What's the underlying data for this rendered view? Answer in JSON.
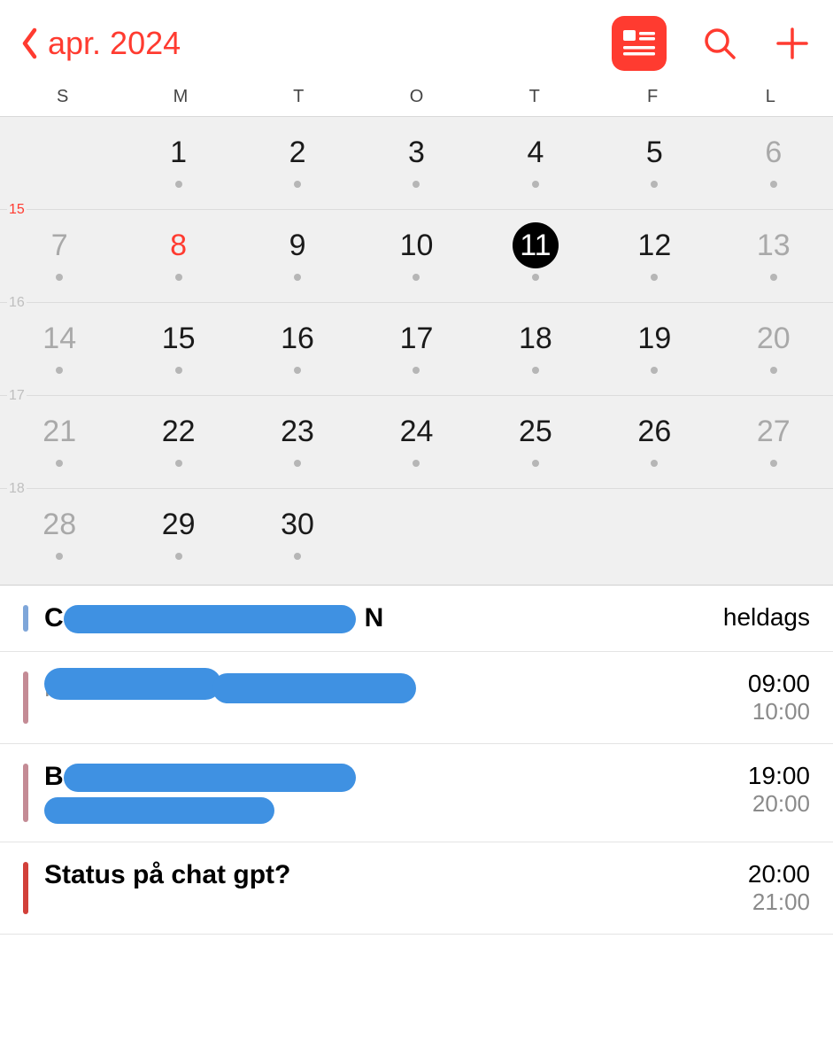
{
  "header": {
    "back_label": "apr. 2024"
  },
  "weekdays": [
    "S",
    "M",
    "T",
    "O",
    "T",
    "F",
    "L"
  ],
  "calendar": {
    "weeks": [
      {
        "number": "15",
        "days": [
          {
            "n": "",
            "dot": false,
            "weekend": true,
            "empty": true
          },
          {
            "n": "1",
            "dot": true,
            "weekend": false
          },
          {
            "n": "2",
            "dot": true,
            "weekend": false
          },
          {
            "n": "3",
            "dot": true,
            "weekend": false
          },
          {
            "n": "4",
            "dot": true,
            "weekend": false
          },
          {
            "n": "5",
            "dot": true,
            "weekend": false
          },
          {
            "n": "6",
            "dot": true,
            "weekend": true
          }
        ]
      },
      {
        "number": "16",
        "days": [
          {
            "n": "7",
            "dot": true,
            "weekend": true
          },
          {
            "n": "8",
            "dot": true,
            "weekend": false,
            "today": true
          },
          {
            "n": "9",
            "dot": true,
            "weekend": false
          },
          {
            "n": "10",
            "dot": true,
            "weekend": false
          },
          {
            "n": "11",
            "dot": true,
            "weekend": false,
            "selected": true
          },
          {
            "n": "12",
            "dot": true,
            "weekend": false
          },
          {
            "n": "13",
            "dot": true,
            "weekend": true
          }
        ]
      },
      {
        "number": "17",
        "days": [
          {
            "n": "14",
            "dot": true,
            "weekend": true
          },
          {
            "n": "15",
            "dot": true,
            "weekend": false
          },
          {
            "n": "16",
            "dot": true,
            "weekend": false
          },
          {
            "n": "17",
            "dot": true,
            "weekend": false
          },
          {
            "n": "18",
            "dot": true,
            "weekend": false
          },
          {
            "n": "19",
            "dot": true,
            "weekend": false
          },
          {
            "n": "20",
            "dot": true,
            "weekend": true
          }
        ]
      },
      {
        "number": "18",
        "days": [
          {
            "n": "21",
            "dot": true,
            "weekend": true
          },
          {
            "n": "22",
            "dot": true,
            "weekend": false
          },
          {
            "n": "23",
            "dot": true,
            "weekend": false
          },
          {
            "n": "24",
            "dot": true,
            "weekend": false
          },
          {
            "n": "25",
            "dot": true,
            "weekend": false
          },
          {
            "n": "26",
            "dot": true,
            "weekend": false
          },
          {
            "n": "27",
            "dot": true,
            "weekend": true
          }
        ]
      },
      {
        "number": "",
        "days": [
          {
            "n": "28",
            "dot": true,
            "weekend": true
          },
          {
            "n": "29",
            "dot": true,
            "weekend": false
          },
          {
            "n": "30",
            "dot": true,
            "weekend": false
          },
          {
            "n": "",
            "dot": false,
            "empty": true
          },
          {
            "n": "",
            "dot": false,
            "empty": true
          },
          {
            "n": "",
            "dot": false,
            "empty": true
          },
          {
            "n": "",
            "dot": false,
            "empty": true
          }
        ]
      }
    ]
  },
  "events": [
    {
      "stripe": "blue",
      "title_visible_prefix": "C",
      "title_visible_suffix": "N",
      "title_redacted": true,
      "subtitle": "",
      "allday_label": "heldags",
      "start": "",
      "end": ""
    },
    {
      "stripe": "rose",
      "title_redacted": true,
      "subtitle_prefix": "Foreslått sted",
      "subtitle_redacted_tail": true,
      "start": "09:00",
      "end": "10:00"
    },
    {
      "stripe": "rose",
      "title_visible_prefix": "B",
      "title_redacted": true,
      "subtitle_redacted_full": true,
      "start": "19:00",
      "end": "20:00"
    },
    {
      "stripe": "red",
      "title": "Status på chat gpt?",
      "start": "20:00",
      "end": "21:00"
    }
  ],
  "colors": {
    "accent": "#ff3b30",
    "smudge": "#3f91e2"
  }
}
